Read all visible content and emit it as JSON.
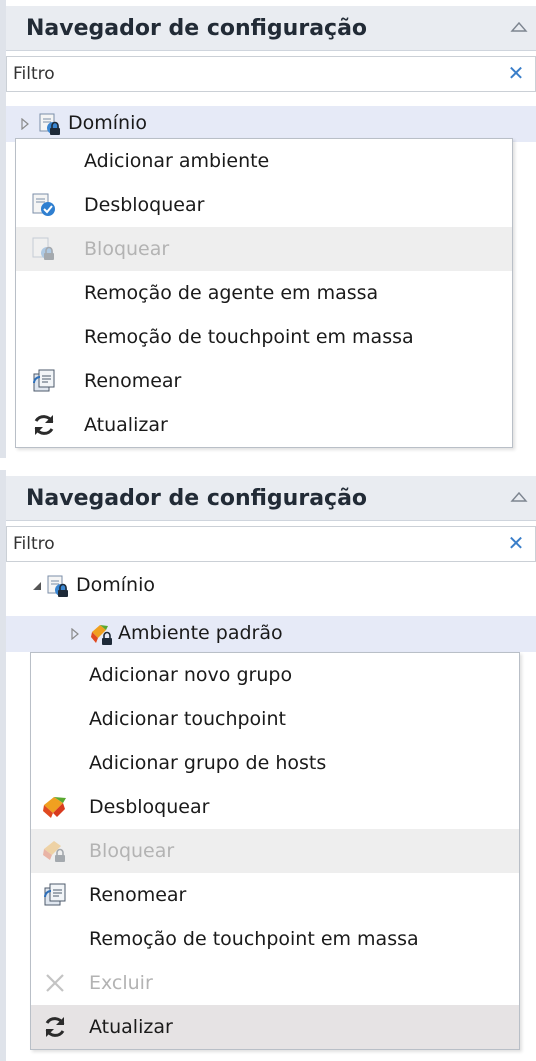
{
  "panels": [
    {
      "header": {
        "title": "Navegador de configuração",
        "collapse_icon": "chevron-up-icon"
      },
      "filter": {
        "value": "Filtro",
        "clear_icon": "close-icon"
      },
      "tree": [
        {
          "label": "Domínio",
          "expanded": false,
          "icon": "domain-locked-icon"
        }
      ],
      "context_menu": [
        {
          "label": "Adicionar ambiente",
          "icon": "",
          "enabled": true
        },
        {
          "label": "Desbloquear",
          "icon": "unlock-domain-icon",
          "enabled": true
        },
        {
          "label": "Bloquear",
          "icon": "lock-domain-icon",
          "enabled": false
        },
        {
          "label": "Remoção de agente em massa",
          "icon": "",
          "enabled": true
        },
        {
          "label": "Remoção de touchpoint em massa",
          "icon": "",
          "enabled": true
        },
        {
          "label": "Renomear",
          "icon": "rename-icon",
          "enabled": true
        },
        {
          "label": "Atualizar",
          "icon": "refresh-icon",
          "enabled": true
        }
      ]
    },
    {
      "header": {
        "title": "Navegador de configuração",
        "collapse_icon": "chevron-up-icon"
      },
      "filter": {
        "value": "Filtro",
        "clear_icon": "close-icon"
      },
      "tree": [
        {
          "label": "Domínio",
          "expanded": true,
          "icon": "domain-locked-icon"
        },
        {
          "label": "Ambiente padrão",
          "expanded": false,
          "icon": "environment-locked-icon"
        }
      ],
      "context_menu": [
        {
          "label": "Adicionar novo grupo",
          "icon": "",
          "enabled": true
        },
        {
          "label": "Adicionar touchpoint",
          "icon": "",
          "enabled": true
        },
        {
          "label": "Adicionar grupo de hosts",
          "icon": "",
          "enabled": true
        },
        {
          "label": "Desbloquear",
          "icon": "unlock-environment-icon",
          "enabled": true
        },
        {
          "label": "Bloquear",
          "icon": "lock-environment-icon",
          "enabled": false
        },
        {
          "label": "Renomear",
          "icon": "rename-icon",
          "enabled": true
        },
        {
          "label": "Remoção de touchpoint em massa",
          "icon": "",
          "enabled": true
        },
        {
          "label": "Excluir",
          "icon": "delete-icon",
          "enabled": false
        },
        {
          "label": "Atualizar",
          "icon": "refresh-icon",
          "enabled": true
        }
      ]
    }
  ],
  "colors": {
    "header_bg": "#e9ecf1",
    "selected_row_bg": "#e6eaf7",
    "menu_hover_bg": "#eeeeee",
    "accent_blue": "#3a7ec9"
  }
}
